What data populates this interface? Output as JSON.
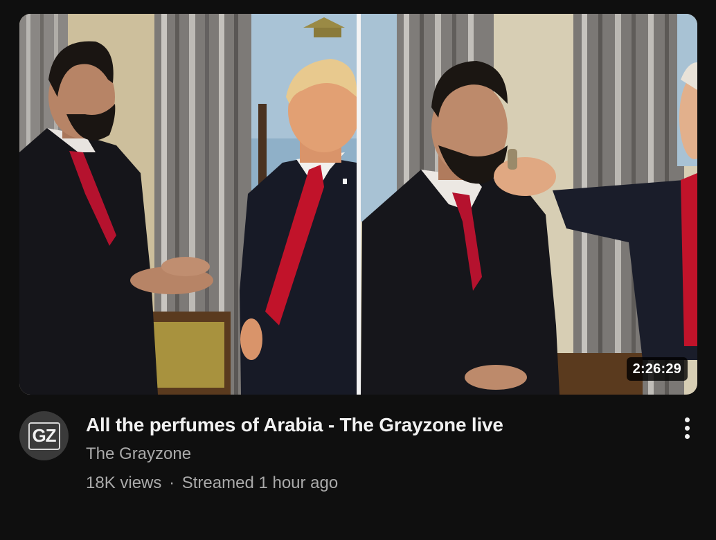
{
  "video": {
    "title": "All the perfumes of Arabia - The Grayzone live",
    "duration": "2:26:29",
    "channel": "The Grayzone",
    "views": "18K views",
    "separator": "·",
    "streamed": "Streamed 1 hour ago"
  },
  "avatar": {
    "initials": "GZ"
  },
  "icons": {
    "menu": "more-vertical-icon"
  },
  "colors": {
    "background": "#0f0f0f",
    "title": "#f1f1f1",
    "secondary_text": "#aaaaaa",
    "tie_red": "#b5122e"
  }
}
